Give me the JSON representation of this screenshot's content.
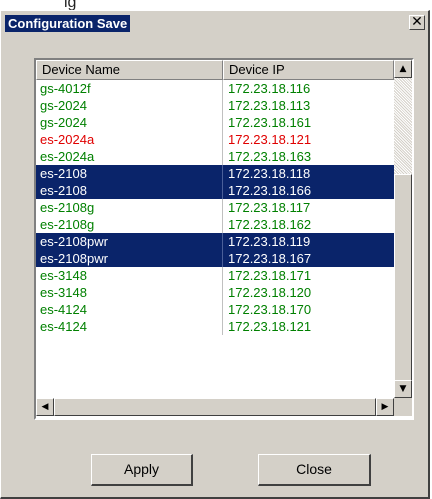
{
  "page_caption_fragment": "ig",
  "window": {
    "title": "Configuration Save",
    "close_glyph": "✕"
  },
  "list": {
    "columns": [
      "Device Name",
      "Device IP"
    ],
    "rows": [
      {
        "name": "gs-4012f",
        "ip": "172.23.18.116",
        "color": "#008000",
        "selected": false
      },
      {
        "name": "gs-2024",
        "ip": "172.23.18.113",
        "color": "#008000",
        "selected": false
      },
      {
        "name": "gs-2024",
        "ip": "172.23.18.161",
        "color": "#008000",
        "selected": false
      },
      {
        "name": "es-2024a",
        "ip": "172.23.18.121",
        "color": "#e00000",
        "selected": false
      },
      {
        "name": "es-2024a",
        "ip": "172.23.18.163",
        "color": "#008000",
        "selected": false
      },
      {
        "name": "es-2108",
        "ip": "172.23.18.118",
        "color": "#ffffff",
        "selected": true
      },
      {
        "name": "es-2108",
        "ip": "172.23.18.166",
        "color": "#ffffff",
        "selected": true
      },
      {
        "name": "es-2108g",
        "ip": "172.23.18.117",
        "color": "#008000",
        "selected": false
      },
      {
        "name": "es-2108g",
        "ip": "172.23.18.162",
        "color": "#008000",
        "selected": false
      },
      {
        "name": "es-2108pwr",
        "ip": "172.23.18.119",
        "color": "#ffffff",
        "selected": true
      },
      {
        "name": "es-2108pwr",
        "ip": "172.23.18.167",
        "color": "#ffffff",
        "selected": true
      },
      {
        "name": "es-3148",
        "ip": "172.23.18.171",
        "color": "#008000",
        "selected": false
      },
      {
        "name": "es-3148",
        "ip": "172.23.18.120",
        "color": "#008000",
        "selected": false
      },
      {
        "name": "es-4124",
        "ip": "172.23.18.170",
        "color": "#008000",
        "selected": false
      },
      {
        "name": "es-4124",
        "ip": "172.23.18.121",
        "color": "#008000",
        "selected": false
      }
    ],
    "scroll_icons": {
      "up": "up-arrow-icon",
      "down": "down-arrow-icon",
      "left": "left-arrow-icon",
      "right": "right-arrow-icon"
    }
  },
  "buttons": {
    "apply": "Apply",
    "close": "Close"
  },
  "colors": {
    "selection": "#0a246a",
    "ok_text": "#008000",
    "error_text": "#e00000"
  }
}
